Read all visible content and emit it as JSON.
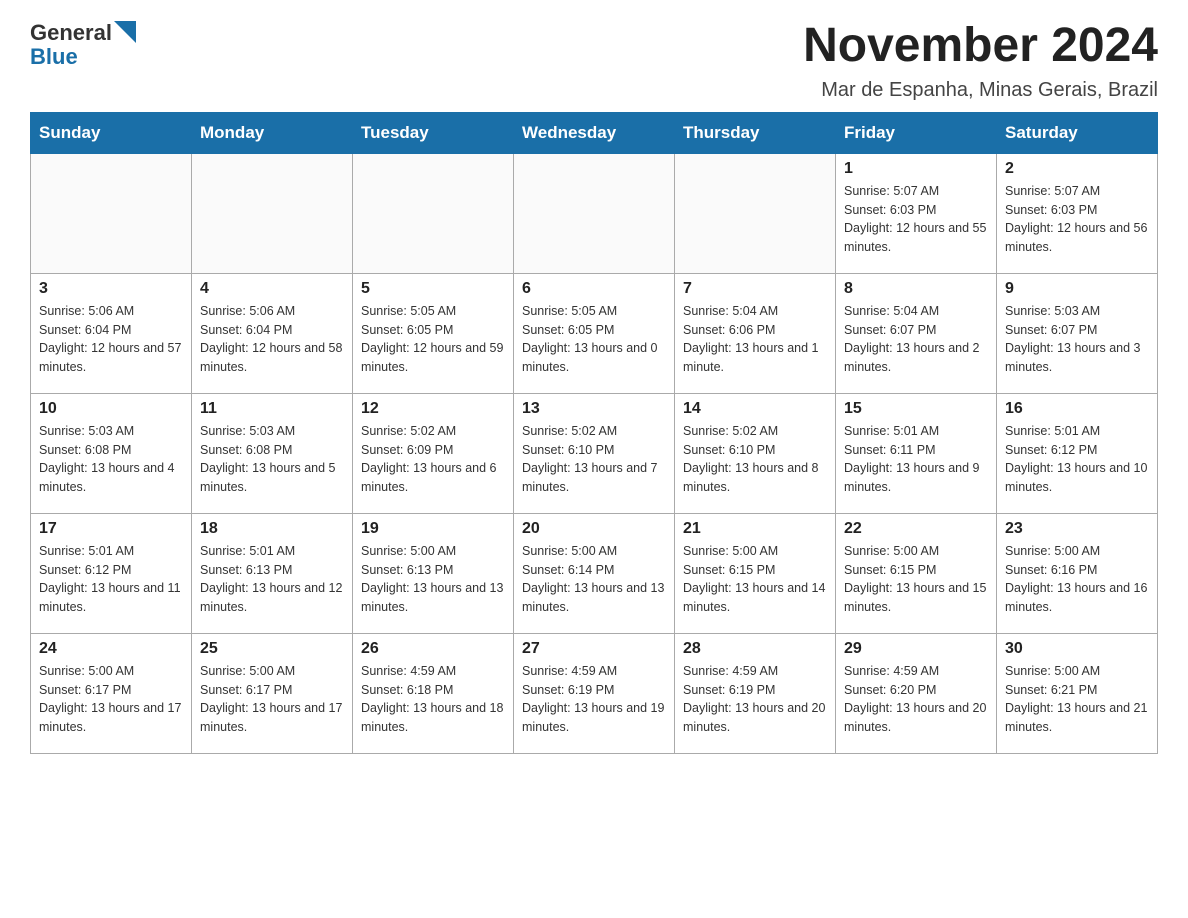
{
  "header": {
    "logo": {
      "general": "General",
      "blue": "Blue"
    },
    "title": "November 2024",
    "subtitle": "Mar de Espanha, Minas Gerais, Brazil"
  },
  "calendar": {
    "days_of_week": [
      "Sunday",
      "Monday",
      "Tuesday",
      "Wednesday",
      "Thursday",
      "Friday",
      "Saturday"
    ],
    "weeks": [
      [
        {
          "day": "",
          "info": ""
        },
        {
          "day": "",
          "info": ""
        },
        {
          "day": "",
          "info": ""
        },
        {
          "day": "",
          "info": ""
        },
        {
          "day": "",
          "info": ""
        },
        {
          "day": "1",
          "info": "Sunrise: 5:07 AM\nSunset: 6:03 PM\nDaylight: 12 hours and 55 minutes."
        },
        {
          "day": "2",
          "info": "Sunrise: 5:07 AM\nSunset: 6:03 PM\nDaylight: 12 hours and 56 minutes."
        }
      ],
      [
        {
          "day": "3",
          "info": "Sunrise: 5:06 AM\nSunset: 6:04 PM\nDaylight: 12 hours and 57 minutes."
        },
        {
          "day": "4",
          "info": "Sunrise: 5:06 AM\nSunset: 6:04 PM\nDaylight: 12 hours and 58 minutes."
        },
        {
          "day": "5",
          "info": "Sunrise: 5:05 AM\nSunset: 6:05 PM\nDaylight: 12 hours and 59 minutes."
        },
        {
          "day": "6",
          "info": "Sunrise: 5:05 AM\nSunset: 6:05 PM\nDaylight: 13 hours and 0 minutes."
        },
        {
          "day": "7",
          "info": "Sunrise: 5:04 AM\nSunset: 6:06 PM\nDaylight: 13 hours and 1 minute."
        },
        {
          "day": "8",
          "info": "Sunrise: 5:04 AM\nSunset: 6:07 PM\nDaylight: 13 hours and 2 minutes."
        },
        {
          "day": "9",
          "info": "Sunrise: 5:03 AM\nSunset: 6:07 PM\nDaylight: 13 hours and 3 minutes."
        }
      ],
      [
        {
          "day": "10",
          "info": "Sunrise: 5:03 AM\nSunset: 6:08 PM\nDaylight: 13 hours and 4 minutes."
        },
        {
          "day": "11",
          "info": "Sunrise: 5:03 AM\nSunset: 6:08 PM\nDaylight: 13 hours and 5 minutes."
        },
        {
          "day": "12",
          "info": "Sunrise: 5:02 AM\nSunset: 6:09 PM\nDaylight: 13 hours and 6 minutes."
        },
        {
          "day": "13",
          "info": "Sunrise: 5:02 AM\nSunset: 6:10 PM\nDaylight: 13 hours and 7 minutes."
        },
        {
          "day": "14",
          "info": "Sunrise: 5:02 AM\nSunset: 6:10 PM\nDaylight: 13 hours and 8 minutes."
        },
        {
          "day": "15",
          "info": "Sunrise: 5:01 AM\nSunset: 6:11 PM\nDaylight: 13 hours and 9 minutes."
        },
        {
          "day": "16",
          "info": "Sunrise: 5:01 AM\nSunset: 6:12 PM\nDaylight: 13 hours and 10 minutes."
        }
      ],
      [
        {
          "day": "17",
          "info": "Sunrise: 5:01 AM\nSunset: 6:12 PM\nDaylight: 13 hours and 11 minutes."
        },
        {
          "day": "18",
          "info": "Sunrise: 5:01 AM\nSunset: 6:13 PM\nDaylight: 13 hours and 12 minutes."
        },
        {
          "day": "19",
          "info": "Sunrise: 5:00 AM\nSunset: 6:13 PM\nDaylight: 13 hours and 13 minutes."
        },
        {
          "day": "20",
          "info": "Sunrise: 5:00 AM\nSunset: 6:14 PM\nDaylight: 13 hours and 13 minutes."
        },
        {
          "day": "21",
          "info": "Sunrise: 5:00 AM\nSunset: 6:15 PM\nDaylight: 13 hours and 14 minutes."
        },
        {
          "day": "22",
          "info": "Sunrise: 5:00 AM\nSunset: 6:15 PM\nDaylight: 13 hours and 15 minutes."
        },
        {
          "day": "23",
          "info": "Sunrise: 5:00 AM\nSunset: 6:16 PM\nDaylight: 13 hours and 16 minutes."
        }
      ],
      [
        {
          "day": "24",
          "info": "Sunrise: 5:00 AM\nSunset: 6:17 PM\nDaylight: 13 hours and 17 minutes."
        },
        {
          "day": "25",
          "info": "Sunrise: 5:00 AM\nSunset: 6:17 PM\nDaylight: 13 hours and 17 minutes."
        },
        {
          "day": "26",
          "info": "Sunrise: 4:59 AM\nSunset: 6:18 PM\nDaylight: 13 hours and 18 minutes."
        },
        {
          "day": "27",
          "info": "Sunrise: 4:59 AM\nSunset: 6:19 PM\nDaylight: 13 hours and 19 minutes."
        },
        {
          "day": "28",
          "info": "Sunrise: 4:59 AM\nSunset: 6:19 PM\nDaylight: 13 hours and 20 minutes."
        },
        {
          "day": "29",
          "info": "Sunrise: 4:59 AM\nSunset: 6:20 PM\nDaylight: 13 hours and 20 minutes."
        },
        {
          "day": "30",
          "info": "Sunrise: 5:00 AM\nSunset: 6:21 PM\nDaylight: 13 hours and 21 minutes."
        }
      ]
    ]
  }
}
